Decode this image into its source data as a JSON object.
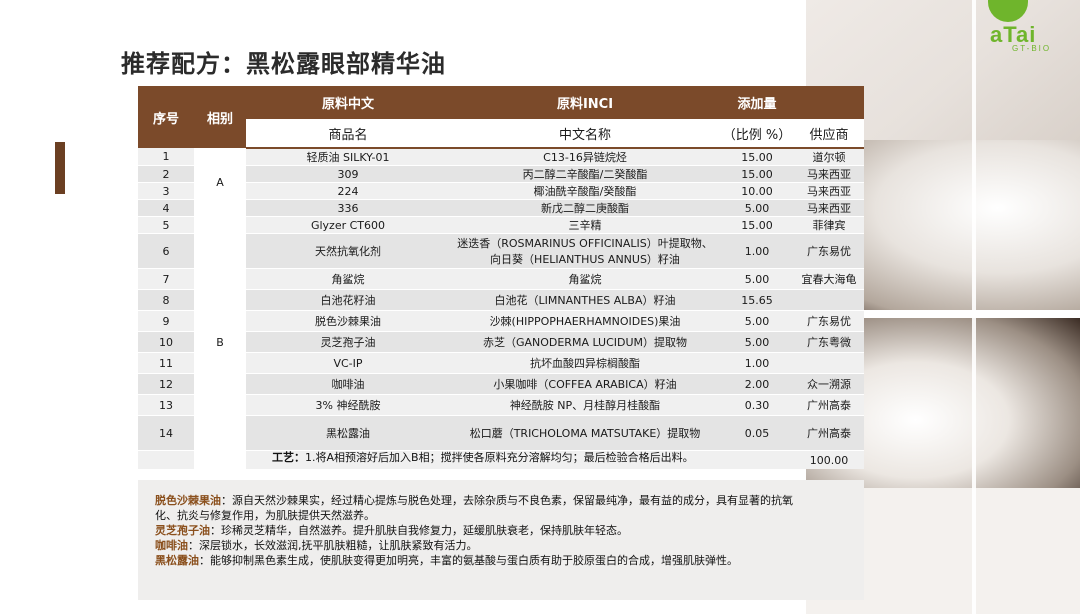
{
  "title": "推荐配方：黑松露眼部精华油",
  "logo": {
    "word": "aTai",
    "sub": "GT-BIO"
  },
  "table": {
    "headers": {
      "seq": "序号",
      "phase": "相别",
      "raw_cn": "原料中文",
      "raw_inci": "原料INCI",
      "amount": "添加量",
      "trade_name": "商品名",
      "cn_name": "中文名称",
      "ratio": "（比例 %）",
      "supplier": "供应商"
    },
    "rows": [
      {
        "no": "1",
        "trade": "轻质油 SILKY-01",
        "cn": "C13-16异链烷烃",
        "ratio": "15.00",
        "supplier": "道尔顿"
      },
      {
        "no": "2",
        "trade": "309",
        "cn": "丙二醇二辛酸酯/二癸酸酯",
        "ratio": "15.00",
        "supplier": "马来西亚"
      },
      {
        "no": "3",
        "trade": "224",
        "cn": "椰油酰辛酸酯/癸酸酯",
        "ratio": "10.00",
        "supplier": "马来西亚"
      },
      {
        "no": "4",
        "trade": "336",
        "cn": "新戊二醇二庚酸酯",
        "ratio": "5.00",
        "supplier": "马来西亚"
      },
      {
        "no": "5",
        "trade": "Glyzer CT600",
        "cn": "三辛精",
        "ratio": "15.00",
        "supplier": "菲律宾"
      },
      {
        "no": "6",
        "trade": "天然抗氧化剂",
        "cn": "迷迭香（ROSMARINUS OFFICINALIS）叶提取物、",
        "cn2": "向日葵（HELIANTHUS ANNUS）籽油",
        "ratio": "1.00",
        "supplier": "广东易优"
      },
      {
        "no": "7",
        "trade": "角鲨烷",
        "cn": "角鲨烷",
        "ratio": "5.00",
        "supplier": "宜春大海龟"
      },
      {
        "no": "8",
        "trade": "白池花籽油",
        "cn": "白池花（LIMNANTHES ALBA）籽油",
        "ratio": "15.65",
        "supplier": ""
      },
      {
        "no": "9",
        "trade": "脱色沙棘果油",
        "cn": "沙棘(HIPPOPHAERHAMNOIDES)果油",
        "ratio": "5.00",
        "supplier": "广东易优"
      },
      {
        "no": "10",
        "trade": "灵芝孢子油",
        "cn": "赤芝（GANODERMA LUCIDUM）提取物",
        "ratio": "5.00",
        "supplier": "广东粤微"
      },
      {
        "no": "11",
        "trade": "VC-IP",
        "cn": "抗坏血酸四异棕榈酸酯",
        "ratio": "1.00",
        "supplier": ""
      },
      {
        "no": "12",
        "trade": "咖啡油",
        "cn": "小果咖啡（COFFEA ARABICA）籽油",
        "ratio": "2.00",
        "supplier": "众一溯源"
      },
      {
        "no": "13",
        "trade": "3% 神经酰胺",
        "cn": "神经酰胺 NP、月桂醇月桂酸酯",
        "ratio": "0.30",
        "supplier": "广州高泰"
      },
      {
        "no": "14",
        "trade": "黑松露油",
        "cn": "松口蘑（TRICHOLOMA MATSUTAKE）提取物",
        "ratio": "0.05",
        "supplier": "广州高泰"
      }
    ],
    "phase_a": "A",
    "phase_b": "B",
    "total": "100.00"
  },
  "process": {
    "label": "工艺：",
    "text": "1.将A相预溶好后加入B相；搅拌使各原料充分溶解均匀；最后检验合格后出料。"
  },
  "notes": [
    {
      "label": "脱色沙棘果油",
      "text": "：源自天然沙棘果实，经过精心提炼与脱色处理，去除杂质与不良色素，保留最纯净，最有益的成分，具有显著的抗氧",
      "text2": "化、抗炎与修复作用，为肌肤提供天然滋养。"
    },
    {
      "label": "灵芝孢子油",
      "text": "：珍稀灵芝精华，自然滋养。提升肌肤自我修复力，延缓肌肤衰老，保持肌肤年轻态。"
    },
    {
      "label": "咖啡油",
      "text": "：深层锁水，长效滋润,抚平肌肤粗糙，让肌肤紧致有活力。"
    },
    {
      "label": "黑松露油",
      "text": "：能够抑制黑色素生成，使肌肤变得更加明亮，丰富的氨基酸与蛋白质有助于胶原蛋白的合成，增强肌肤弹性。"
    }
  ]
}
